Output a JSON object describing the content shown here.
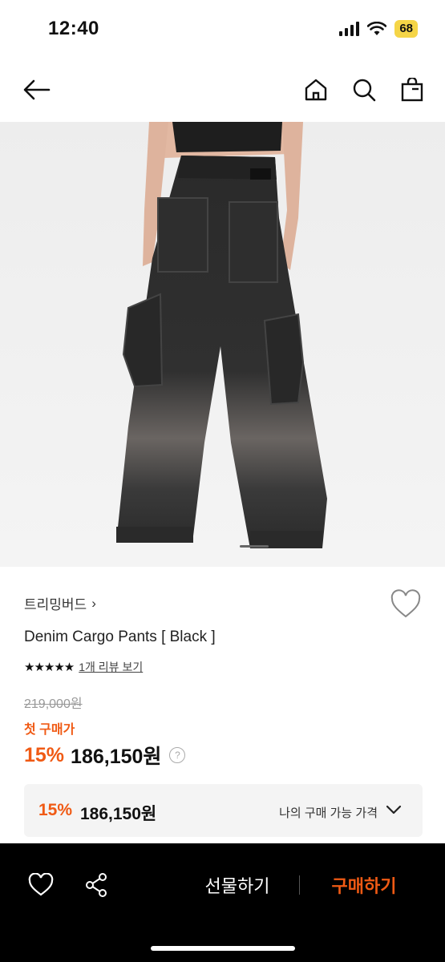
{
  "status": {
    "time": "12:40",
    "battery": "68"
  },
  "nav": {
    "icons": [
      "back-arrow-icon",
      "home-icon",
      "search-icon",
      "shopping-bag-icon"
    ]
  },
  "product": {
    "brand": "트리밍버드",
    "brand_chevron": "›",
    "name": "Denim Cargo Pants [ Black ]",
    "stars": "★★★★★",
    "review_link": "1개 리뷰 보기",
    "original_price": "219,000원",
    "first_purchase_label": "첫 구매가",
    "discount": "15%",
    "price": "186,150원",
    "help": "?"
  },
  "my_price": {
    "discount": "15%",
    "price": "186,150원",
    "label": "나의 구매 가능 가격"
  },
  "bottom_bar": {
    "gift_label": "선물하기",
    "buy_label": "구매하기"
  },
  "colors": {
    "accent": "#f05a14",
    "bar": "#000000"
  }
}
